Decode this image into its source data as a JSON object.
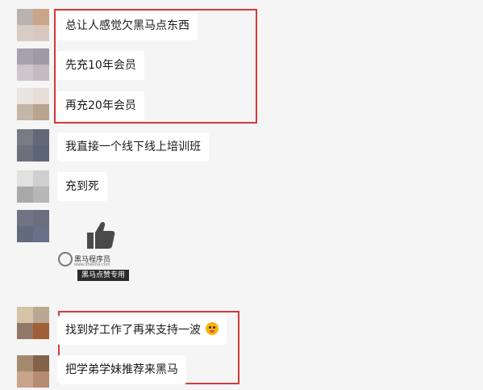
{
  "messages": [
    {
      "text": "总让人感觉欠黑马点东西"
    },
    {
      "text": "先充10年会员"
    },
    {
      "text": "再充20年会员"
    },
    {
      "text": "我直接一个线下线上培训班"
    },
    {
      "text": "充到死"
    },
    {
      "text": "找到好工作了再来支持一波"
    },
    {
      "text": "把学弟学妹推荐来黑马"
    }
  ],
  "sticker": {
    "icon": "thumbs-up-icon",
    "logo_text": "黑马程序员",
    "logo_url": "www.itheima.com",
    "tag": "黑马点赞专用"
  },
  "colors": {
    "background": "#f5f5f5",
    "bubble": "#ffffff",
    "highlight": "#d23a3a"
  }
}
